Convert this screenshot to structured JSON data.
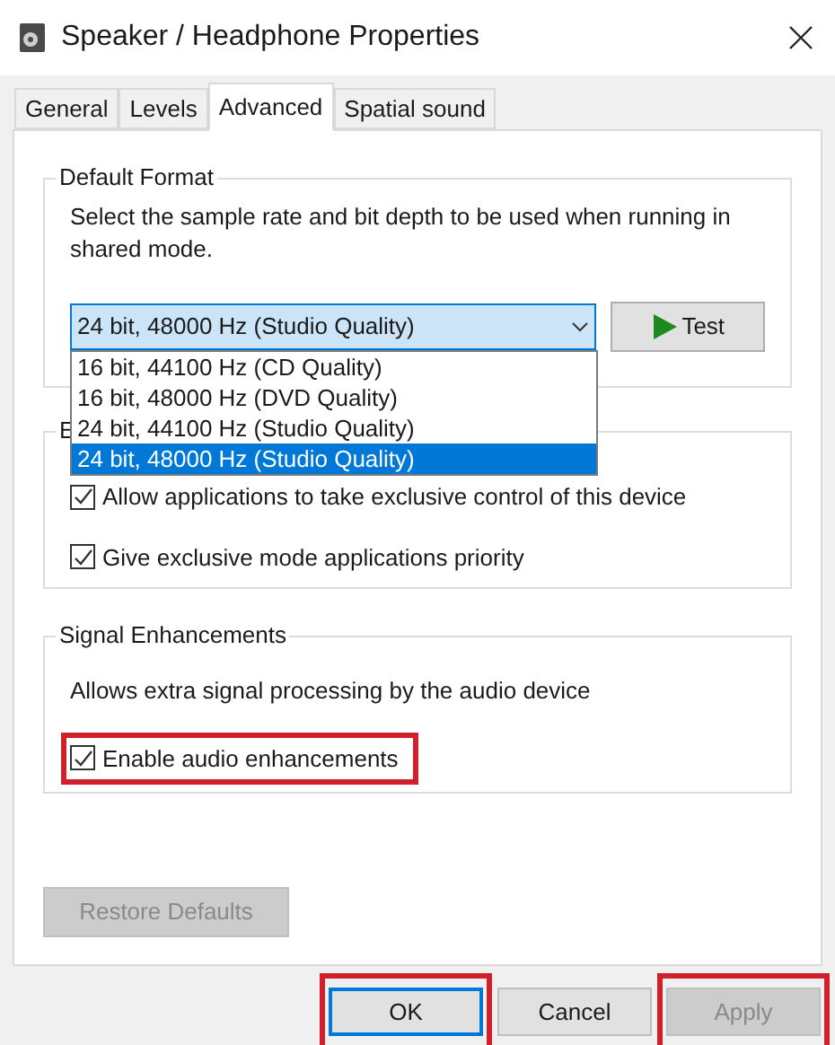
{
  "window": {
    "title": "Speaker / Headphone Properties"
  },
  "tabs": [
    {
      "label": "General",
      "selected": false
    },
    {
      "label": "Levels",
      "selected": false
    },
    {
      "label": "Advanced",
      "selected": true
    },
    {
      "label": "Spatial sound",
      "selected": false
    }
  ],
  "default_format": {
    "title": "Default Format",
    "description": "Select the sample rate and bit depth to be used when running in shared mode.",
    "combo_value": "24 bit, 48000 Hz (Studio Quality)",
    "test_button": "Test",
    "options": [
      {
        "label": "16 bit, 44100 Hz (CD Quality)",
        "selected": false
      },
      {
        "label": "16 bit, 48000 Hz (DVD Quality)",
        "selected": false
      },
      {
        "label": "24 bit, 44100 Hz (Studio Quality)",
        "selected": false
      },
      {
        "label": "24 bit, 48000 Hz (Studio Quality)",
        "selected": true
      }
    ]
  },
  "exclusive_mode": {
    "title": "E",
    "checkboxes": [
      {
        "label": "Allow applications to take exclusive control of this device",
        "checked": true
      },
      {
        "label": "Give exclusive mode applications priority",
        "checked": true
      }
    ]
  },
  "signal_enhancements": {
    "title": "Signal Enhancements",
    "description": "Allows extra signal processing by the audio device",
    "checkbox": {
      "label": "Enable audio enhancements",
      "checked": true,
      "highlighted": true
    }
  },
  "restore_button": {
    "label": "Restore Defaults",
    "disabled": true
  },
  "buttons": [
    {
      "label": "OK",
      "kind": "default",
      "disabled": false,
      "highlighted": true
    },
    {
      "label": "Cancel",
      "kind": "normal",
      "disabled": false,
      "highlighted": false
    },
    {
      "label": "Apply",
      "kind": "normal",
      "disabled": true,
      "highlighted": true
    }
  ]
}
